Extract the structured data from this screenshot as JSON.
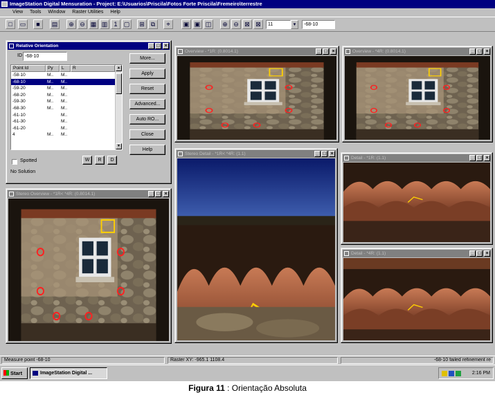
{
  "app": {
    "title": "ImageStation Digital Mensuration - Project: E:\\Usuarios\\Priscila\\Fotos Forte Priscila\\Fremeiro\\terrestre",
    "menus": [
      "View",
      "Tools",
      "Window",
      "Raster Utilities",
      "Help"
    ]
  },
  "toolbar": {
    "combo1_value": "11",
    "combo2_value": "-68-10"
  },
  "ro_dialog": {
    "title": "Relative Orientation",
    "id_label": "ID",
    "id_value": "-68-10",
    "columns": [
      "Point Id",
      "Py",
      "L",
      "R"
    ],
    "rows": [
      [
        "-58-10",
        "M..",
        "M..",
        ""
      ],
      [
        "-68-10",
        "M..",
        "M..",
        ""
      ],
      [
        "-59-20",
        "M..",
        "M..",
        ""
      ],
      [
        "-68-20",
        "M..",
        "M..",
        ""
      ],
      [
        "-59-30",
        "M..",
        "M..",
        ""
      ],
      [
        "-68-30",
        "M..",
        "M..",
        ""
      ],
      [
        "-61-10",
        "",
        "M..",
        ""
      ],
      [
        "-61-30",
        "",
        "M..",
        ""
      ],
      [
        "-61-20",
        "",
        "M..",
        ""
      ],
      [
        "4",
        "M..",
        "M..",
        ""
      ]
    ],
    "selected_row": 1,
    "buttons": [
      "More...",
      "Apply",
      "Reset",
      "Advanced...",
      "Auto RO...",
      "Close",
      "Help"
    ],
    "spotted_label": "Spotted",
    "small_buttons": [
      "W",
      "R",
      "D"
    ],
    "status": "No Solution"
  },
  "windows": {
    "overview_left": {
      "title": "Overview - *1R: (0.8014.1)"
    },
    "overview_right": {
      "title": "Overview - *4R: (0.8014.1)"
    },
    "stereo_overview": {
      "title": "Stereo Overview - *1R< *4R: (0.8014.1)"
    },
    "stereo_detail": {
      "title": "Stereo Detail - *1R< *4R: (1.1)"
    },
    "detail_top": {
      "title": "Detail - *1R: (1.1)"
    },
    "detail_bottom": {
      "title": "Detail - *4R: (1.1)"
    }
  },
  "statusbar": {
    "left": "Measure point -68-10",
    "middle": "Raster XY: -965.1 1108.4",
    "right": "-68-10 failed refinement re"
  },
  "taskbar": {
    "start": "Start",
    "task": "ImageStation Digital ...",
    "clock": "2:16 PM"
  },
  "caption": {
    "label": "Figura 11",
    "text": " : Orientação Absoluta"
  }
}
